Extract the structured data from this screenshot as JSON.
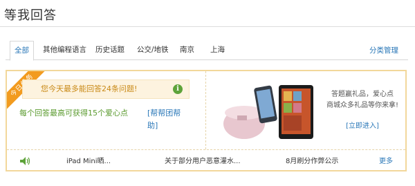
{
  "page": {
    "title": "等我回答"
  },
  "tabs": [
    {
      "label": "全部",
      "active": true
    },
    {
      "label": "其他编程语言"
    },
    {
      "label": "历史话题"
    },
    {
      "label": "公交/地铁"
    },
    {
      "label": "南京"
    },
    {
      "label": "上海"
    }
  ],
  "manage_link": "分类管理",
  "ribbon": "今日任务",
  "notice": {
    "text": "您今天最多能回答24条问题!",
    "icon": "info-icon"
  },
  "reward": {
    "text": "每个回答最高可获得15个爱心点",
    "link": "[帮帮团帮助]"
  },
  "promo": {
    "line1": "答题赢礼品，爱心点",
    "line2": "商城众多礼品等你来拿!",
    "link": "[立即进入]"
  },
  "news": [
    {
      "text": "iPad Mini晒..."
    },
    {
      "text": "关于部分用户恶意灌水..."
    },
    {
      "text": "8月刷分作弊公示"
    }
  ],
  "more_link": "更多",
  "colors": {
    "accent": "#2b78b8",
    "ribbon": "#f29b1f",
    "panel_border": "#f2d79a",
    "notice_text": "#c98a17",
    "reward_text": "#5a9a2e"
  }
}
